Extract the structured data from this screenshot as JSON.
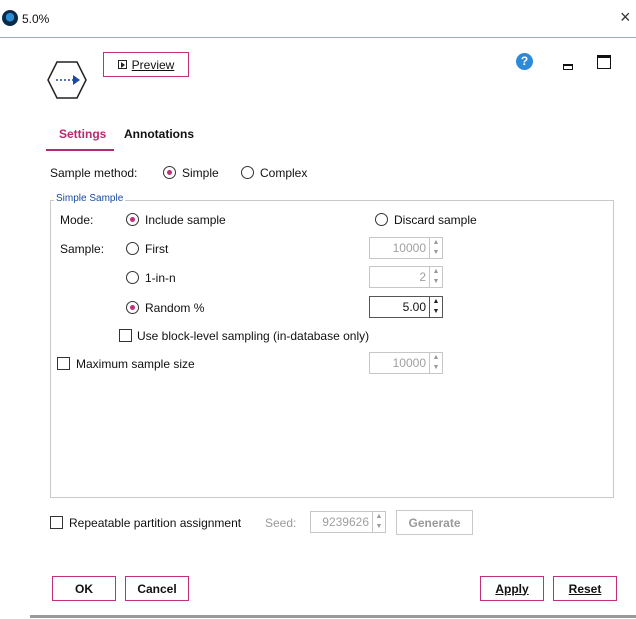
{
  "window": {
    "title": "5.0%",
    "close": "×"
  },
  "toolbar": {
    "preview_label": "Preview",
    "help": "?"
  },
  "tabs": [
    {
      "label": "Settings",
      "active": true
    },
    {
      "label": "Annotations",
      "active": false
    }
  ],
  "sample_method": {
    "label": "Sample method:",
    "options": [
      "Simple",
      "Complex"
    ],
    "selected": "Simple"
  },
  "simple_sample": {
    "group_title": "Simple Sample",
    "mode_label": "Mode:",
    "mode_options": [
      "Include sample",
      "Discard sample"
    ],
    "mode_selected": "Include sample",
    "sample_label": "Sample:",
    "sample_options": [
      {
        "label": "First",
        "value": "10000"
      },
      {
        "label": "1-in-n",
        "value": "2"
      },
      {
        "label": "Random %",
        "value": "5.00"
      }
    ],
    "sample_selected": "Random %",
    "block_level_label": "Use block-level sampling (in-database only)",
    "max_size_label": "Maximum sample size",
    "max_size_value": "10000"
  },
  "partition": {
    "label": "Repeatable partition assignment",
    "seed_label": "Seed:",
    "seed_value": "9239626",
    "generate_label": "Generate"
  },
  "buttons": {
    "ok": "OK",
    "cancel": "Cancel",
    "apply": "Apply",
    "reset": "Reset"
  },
  "colors": {
    "accent": "#c1307a",
    "help": "#2d8ad8",
    "group_title": "#1a4aa0"
  },
  "icons": [
    "app-icon",
    "sample-node-icon",
    "preview-play-icon",
    "help-icon",
    "minimize-icon",
    "maximize-icon",
    "close-icon"
  ]
}
